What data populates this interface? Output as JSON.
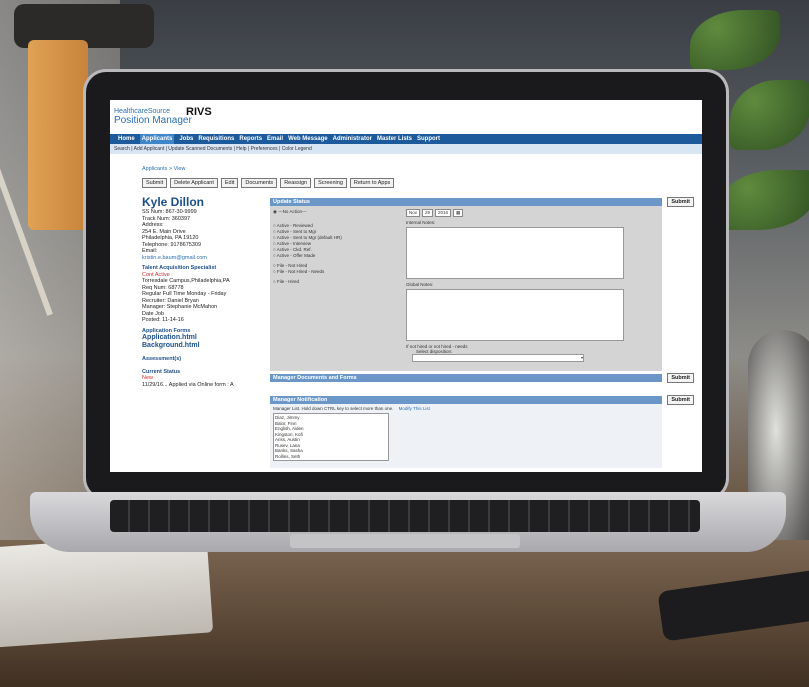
{
  "app": {
    "logo_top": "HealthcareSource",
    "logo_main": "Position Manager",
    "title": "RIVS"
  },
  "nav": [
    "Home",
    "Applicants",
    "Jobs",
    "Requisitions",
    "Reports",
    "Email",
    "Web Message",
    "Administrator",
    "Master Lists",
    "Support"
  ],
  "subnav": "Search  |  Add Applicant  |  Update Scanned Documents  |  Help  |  Preferences  |  Color Legend",
  "breadcrumb": "Applicants > View",
  "buttons": [
    "Submit",
    "Delete Applicant",
    "Edit",
    "Documents",
    "Reassign",
    "Screening",
    "Return to Apps"
  ],
  "applicant": {
    "name": "Kyle Dillon",
    "ss": "SS Num:      867-30-9999",
    "track": "Track Num:    360397",
    "address_label": "Address:",
    "addr1": "254 E. Main Drive",
    "addr2": "Philadelphia, PA 19120",
    "phone": "Telephone:       9178675309",
    "email_label": "Email:",
    "email": "kristin.e.baum@gmail.com",
    "job_title": "Talent Acquisition Specialist",
    "job_status": "Cont Active",
    "campus": "Torresdale Campus,Philadelphia,PA",
    "req": "Req Num:       68778",
    "sched": "Regular Full Time Monday - Friday",
    "recruiter": "Recruiter:       Daniel Bryan",
    "manager": "Manager:        Stephanie McMahon",
    "date_job": "Date Job",
    "posted": "Posted:          11-14-16",
    "forms_head": "Application Forms",
    "form1": "Application.html",
    "form2": "Background.html",
    "assess_head": "Assessment(s)",
    "current_head": "Current Status",
    "current_status": "New",
    "current_note": "11/29/16... Applied via Online form : A"
  },
  "update_status": {
    "title": "Update Status",
    "submit": "Submit",
    "options": [
      "---No Action---",
      "Active - Reviewed",
      "Active - Sent to Mgr",
      "Active - Sent to Mgr (default HR)",
      "Active - Interview",
      "Active - Ckd. Ref.",
      "Active - Offer Made",
      "File - Not Hired",
      "File - Not Hired - Needs",
      "File - Hired"
    ],
    "date": [
      "Nov",
      "29",
      "2016"
    ],
    "internal": "Internal Notes:",
    "global": "Global Notes:",
    "warn": "If not hired or not hired - needs",
    "disp": "Select disposition:"
  },
  "mgr_docs": {
    "title": "Manager Documents and Forms",
    "submit": "Submit"
  },
  "mgr_notif": {
    "title": "Manager Notification",
    "submit": "Submit",
    "hint": "Manager List. Hold down CTRL key to select more than one.",
    "link": "Modify This List",
    "managers": [
      "Diaz, Jimmy",
      "Balor, Finn",
      "English, Aiden",
      "Kingston, Kofi",
      "Ariss, Austin",
      "Rusev, Lana",
      "Banks, Sasha",
      "Rollins, Seth"
    ]
  }
}
